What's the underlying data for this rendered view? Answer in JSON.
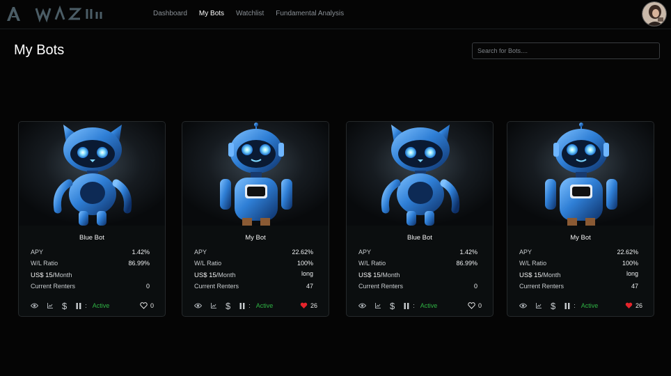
{
  "logo_text": "WAZII",
  "nav": [
    "Dashboard",
    "My Bots",
    "Watchlist",
    "Fundamental Analysis"
  ],
  "nav_active_index": 1,
  "page_title": "My Bots",
  "search": {
    "placeholder": "Search for Bots...."
  },
  "labels": {
    "apy": "APY",
    "wl_ratio": "W/L Ratio",
    "price_currency": "US$ 15/",
    "price_period": "Month",
    "current_renters": "Current Renters",
    "colon": ":"
  },
  "colors": {
    "active": "#2fb344",
    "heart_filled": "#e5242b",
    "robot_blue": "#2f7fd6"
  },
  "bots": [
    {
      "name": "Blue Bot",
      "image": "cat-robot",
      "apy": "1.42%",
      "wl_ratio": "86.99%",
      "term": "",
      "renters": "0",
      "status": "Active",
      "likes": "0",
      "liked": false
    },
    {
      "name": "My Bot",
      "image": "antenna-robot",
      "apy": "22.62%",
      "wl_ratio": "100%",
      "term": "long",
      "renters": "47",
      "status": "Active",
      "likes": "26",
      "liked": true
    },
    {
      "name": "Blue Bot",
      "image": "cat-robot",
      "apy": "1.42%",
      "wl_ratio": "86.99%",
      "term": "",
      "renters": "0",
      "status": "Active",
      "likes": "0",
      "liked": false
    },
    {
      "name": "My Bot",
      "image": "antenna-robot",
      "apy": "22.62%",
      "wl_ratio": "100%",
      "term": "long",
      "renters": "47",
      "status": "Active",
      "likes": "26",
      "liked": true
    }
  ]
}
